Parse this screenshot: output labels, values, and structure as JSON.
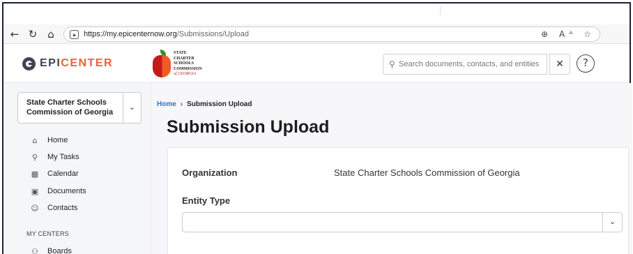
{
  "browser": {
    "url_host": "https://my.epicenternow.org",
    "url_path": "/Submissions/Upload",
    "back_glyph": "←",
    "reload_glyph": "↻",
    "home_glyph": "⌂",
    "actions_glyphs": "⊕ Aᴬ ☆"
  },
  "header": {
    "logo_prefix": "EPI",
    "logo_suffix": "CENTER",
    "org_logo_lines": [
      "STATE",
      "CHARTER",
      "SCHOOLS",
      "COMMISSION"
    ],
    "org_logo_last": "of GEORGIA",
    "search_placeholder": "Search documents, contacts, and entities",
    "clear_glyph": "✕",
    "help_glyph": "?"
  },
  "sidebar": {
    "org_selector": "State Charter Schools Commission of Georgia",
    "items": [
      {
        "label": "Home",
        "icon": "⌂"
      },
      {
        "label": "My Tasks",
        "icon": "⚲"
      },
      {
        "label": "Calendar",
        "icon": "▦"
      },
      {
        "label": "Documents",
        "icon": "▣"
      },
      {
        "label": "Contacts",
        "icon": "☺"
      }
    ],
    "section_title": "MY CENTERS",
    "center_items": [
      {
        "label": "Boards",
        "icon": "⚇"
      }
    ]
  },
  "main": {
    "breadcrumb_home": "Home",
    "breadcrumb_sep": "›",
    "breadcrumb_current": "Submission Upload",
    "title": "Submission Upload",
    "organization_label": "Organization",
    "organization_value": "State Charter Schools Commission of Georgia",
    "entity_type_label": "Entity Type",
    "entity_type_value": ""
  },
  "colors": {
    "brand_dark": "#3f4451",
    "brand_accent": "#e8623b",
    "link_blue": "#2f6fd1"
  }
}
